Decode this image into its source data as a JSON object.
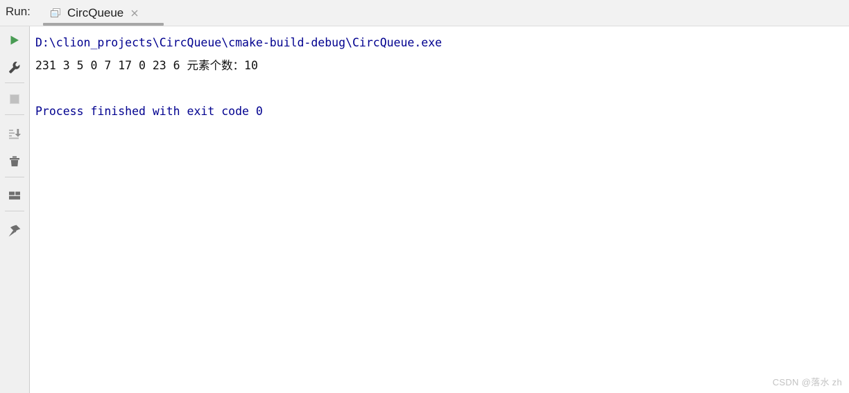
{
  "window": {
    "run_label": "Run:",
    "background": "#ffffff"
  },
  "tab": {
    "label": "CircQueue",
    "icon": "application-window-icon",
    "close_icon": "close-icon",
    "selected": true,
    "accent": "#a6a6a6"
  },
  "sidebar": {
    "items": [
      {
        "name": "rerun-button",
        "icon": "play-icon",
        "color": "#499c54"
      },
      {
        "name": "edit-configuration-button",
        "icon": "wrench-icon",
        "color": "#4a4a4a"
      },
      {
        "name": "stop-button",
        "icon": "stop-square-icon",
        "color": "#c0c0c0"
      },
      {
        "name": "scroll-to-end-button",
        "icon": "scroll-to-end-icon",
        "color": "#b8b8b8"
      },
      {
        "name": "clear-all-button",
        "icon": "trash-icon",
        "color": "#6e6e6e"
      },
      {
        "name": "layout-settings-button",
        "icon": "layout-grid-icon",
        "color": "#6e6e6e"
      },
      {
        "name": "pin-tab-button",
        "icon": "pin-icon",
        "color": "#6e6e6e"
      }
    ]
  },
  "console": {
    "lines": [
      {
        "id": "command-line",
        "text": "D:\\clion_projects\\CircQueue\\cmake-build-debug\\CircQueue.exe",
        "style": "cmd",
        "color": "#00008f"
      },
      {
        "id": "program-output-line",
        "text": "231 3 5 0 7 17 0 23 6 元素个数：10",
        "style": "out",
        "color": "#101010"
      },
      {
        "id": "blank-line",
        "text": " ",
        "style": "blank",
        "color": "#ffffff"
      },
      {
        "id": "exit-status-line",
        "text": "Process finished with exit code 0",
        "style": "exit",
        "color": "#00008f"
      }
    ]
  },
  "watermark": {
    "text": "CSDN @落水 zh",
    "color": "#c3c3c3"
  }
}
